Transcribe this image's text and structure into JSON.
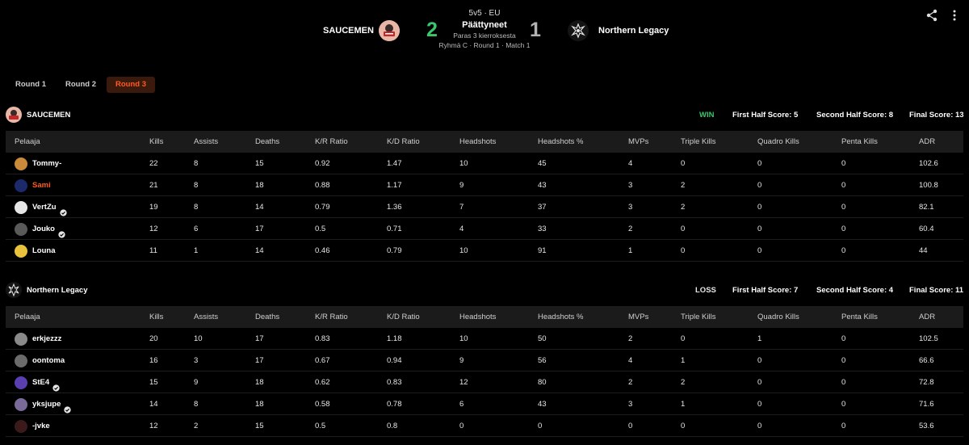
{
  "header": {
    "team_left": "SAUCEMEN",
    "team_right": "Northern Legacy",
    "score_left": "2",
    "score_right": "1",
    "mode": "5v5 · EU",
    "status": "Päättyneet",
    "best_of": "Paras 3 kierroksesta",
    "match_info": "Ryhmä C · Round 1 · Match 1"
  },
  "icons": {
    "share": "share-icon",
    "more": "more-vertical-icon",
    "verified": "verified-badge-icon"
  },
  "colors": {
    "accent": "#ff5a1f",
    "win": "#3ac66a",
    "loss_score": "#b3b3b3"
  },
  "tabs": [
    {
      "label": "Round 1",
      "active": false
    },
    {
      "label": "Round 2",
      "active": false
    },
    {
      "label": "Round 3",
      "active": true
    }
  ],
  "columns": [
    "Pelaaja",
    "Kills",
    "Assists",
    "Deaths",
    "K/R Ratio",
    "K/D Ratio",
    "Headshots",
    "Headshots %",
    "MVPs",
    "Triple Kills",
    "Quadro Kills",
    "Penta Kills",
    "ADR"
  ],
  "teams": [
    {
      "name": "SAUCEMEN",
      "result": "WIN",
      "first_half": "First Half Score: 5",
      "second_half": "Second Half Score: 8",
      "final": "Final Score: 13",
      "players": [
        {
          "name": "Tommy-",
          "verified": false,
          "highlight": false,
          "avatar": "#c98a3a",
          "stats": [
            "22",
            "8",
            "15",
            "0.92",
            "1.47",
            "10",
            "45",
            "4",
            "0",
            "0",
            "0",
            "102.6"
          ]
        },
        {
          "name": "Sami",
          "verified": false,
          "highlight": true,
          "avatar": "#1c2a6b",
          "stats": [
            "21",
            "8",
            "18",
            "0.88",
            "1.17",
            "9",
            "43",
            "3",
            "2",
            "0",
            "0",
            "100.8"
          ]
        },
        {
          "name": "VertZu",
          "verified": true,
          "highlight": false,
          "avatar": "#e6e6e6",
          "stats": [
            "19",
            "8",
            "14",
            "0.79",
            "1.36",
            "7",
            "37",
            "3",
            "2",
            "0",
            "0",
            "82.1"
          ]
        },
        {
          "name": "Jouko",
          "verified": true,
          "highlight": false,
          "avatar": "#5a5a5a",
          "stats": [
            "12",
            "6",
            "17",
            "0.5",
            "0.71",
            "4",
            "33",
            "2",
            "0",
            "0",
            "0",
            "60.4"
          ]
        },
        {
          "name": "Louna",
          "verified": false,
          "highlight": false,
          "avatar": "#e8c23a",
          "stats": [
            "11",
            "1",
            "14",
            "0.46",
            "0.79",
            "10",
            "91",
            "1",
            "0",
            "0",
            "0",
            "44"
          ]
        }
      ]
    },
    {
      "name": "Northern Legacy",
      "result": "LOSS",
      "first_half": "First Half Score: 7",
      "second_half": "Second Half Score: 4",
      "final": "Final Score: 11",
      "players": [
        {
          "name": "erkjezzz",
          "verified": false,
          "highlight": false,
          "avatar": "#8a8a8a",
          "stats": [
            "20",
            "10",
            "17",
            "0.83",
            "1.18",
            "10",
            "50",
            "2",
            "0",
            "1",
            "0",
            "102.5"
          ]
        },
        {
          "name": "oontoma",
          "verified": false,
          "highlight": false,
          "avatar": "#6b6b6b",
          "stats": [
            "16",
            "3",
            "17",
            "0.67",
            "0.94",
            "9",
            "56",
            "4",
            "1",
            "0",
            "0",
            "66.6"
          ]
        },
        {
          "name": "StE4",
          "verified": true,
          "highlight": false,
          "avatar": "#5a3fb0",
          "stats": [
            "15",
            "9",
            "18",
            "0.62",
            "0.83",
            "12",
            "80",
            "2",
            "2",
            "0",
            "0",
            "72.8"
          ]
        },
        {
          "name": "yksjupe",
          "verified": true,
          "highlight": false,
          "avatar": "#7a6a9a",
          "stats": [
            "14",
            "8",
            "18",
            "0.58",
            "0.78",
            "6",
            "43",
            "3",
            "1",
            "0",
            "0",
            "71.6"
          ]
        },
        {
          "name": "-jvke",
          "verified": false,
          "highlight": false,
          "avatar": "#3a1a1a",
          "stats": [
            "12",
            "2",
            "15",
            "0.5",
            "0.8",
            "0",
            "0",
            "0",
            "0",
            "0",
            "0",
            "53.6"
          ]
        }
      ]
    }
  ]
}
